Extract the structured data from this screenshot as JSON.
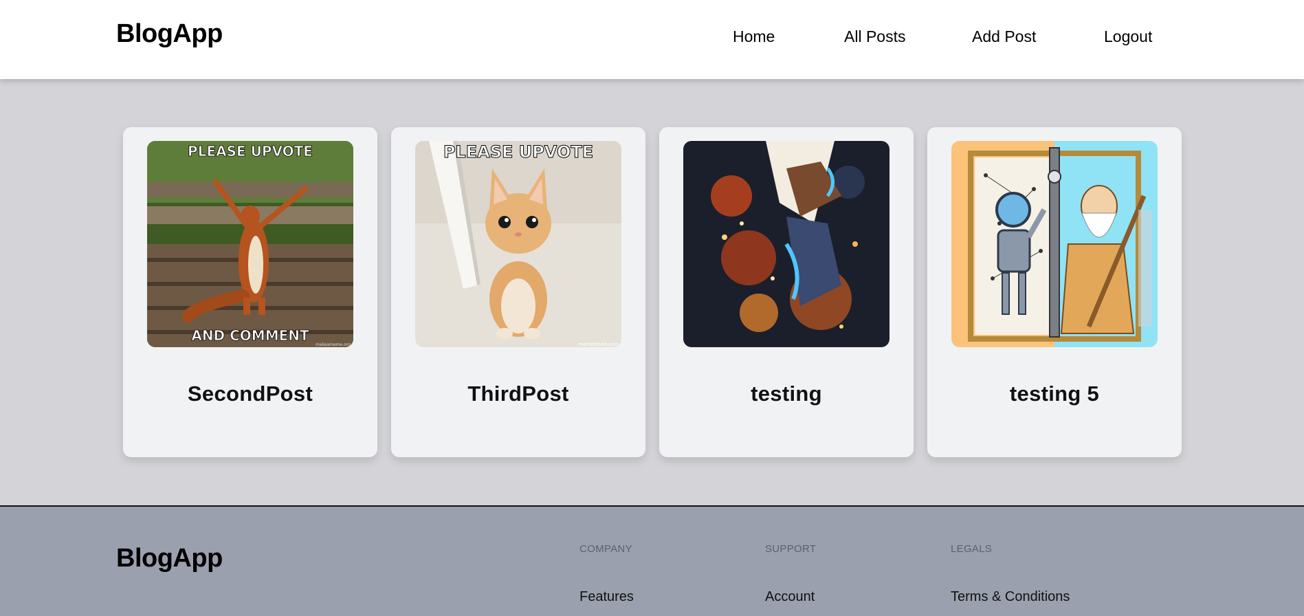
{
  "header": {
    "logo": "BlogApp",
    "nav": [
      "Home",
      "All Posts",
      "Add Post",
      "Logout"
    ]
  },
  "posts": [
    {
      "title": "SecondPost",
      "image_caption_top": "PLEASE UPVOTE",
      "image_caption_bottom": "AND COMMENT",
      "image_watermark": "makeameme.org"
    },
    {
      "title": "ThirdPost",
      "image_caption_top": "PLEASE UPVOTE",
      "image_watermark": "memesfeed.com"
    },
    {
      "title": "testing"
    },
    {
      "title": "testing 5"
    }
  ],
  "footer": {
    "logo": "BlogApp",
    "columns": [
      {
        "heading": "COMPANY",
        "link": "Features"
      },
      {
        "heading": "SUPPORT",
        "link": "Account"
      },
      {
        "heading": "LEGALS",
        "link": "Terms & Conditions"
      }
    ]
  },
  "colors": {
    "page_bg": "#d4d4d8",
    "header_bg": "#ffffff",
    "card_bg": "#f1f2f4",
    "footer_bg": "#9aa0ad"
  }
}
